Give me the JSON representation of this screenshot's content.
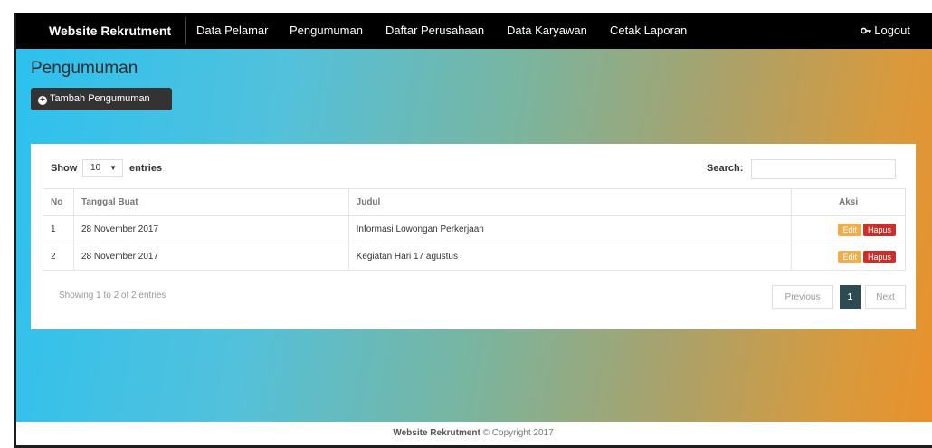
{
  "navbar": {
    "brand": "Website Rekrutment",
    "links": [
      "Data Pelamar",
      "Pengumuman",
      "Daftar Perusahaan",
      "Data Karyawan",
      "Cetak Laporan"
    ],
    "logout": "Logout"
  },
  "page": {
    "title": "Pengumuman",
    "add_button": "Tambah Pengumuman"
  },
  "table_controls": {
    "show": "Show",
    "length_value": "10",
    "entries": "entries",
    "search_label": "Search:",
    "search_value": ""
  },
  "table": {
    "headers": [
      "No",
      "Tanggal Buat",
      "Judul",
      "Aksi"
    ],
    "rows": [
      {
        "no": "1",
        "date": "28 November 2017",
        "title": "Informasi Lowongan Perkerjaan",
        "edit": "Edit",
        "delete": "Hapus"
      },
      {
        "no": "2",
        "date": "28 November 2017",
        "title": "Kegiatan Hari 17 agustus",
        "edit": "Edit",
        "delete": "Hapus"
      }
    ]
  },
  "pagination": {
    "info": "Showing 1 to 2 of 2 entries",
    "previous": "Previous",
    "current": "1",
    "next": "Next"
  },
  "footer": {
    "brand": "Website Rekrutment",
    "copyright": "© Copyright 2017"
  },
  "colors": {
    "navbar": "#000000",
    "edit": "#f0ad4e",
    "delete": "#c9302c",
    "active_page": "#2e4a52"
  }
}
